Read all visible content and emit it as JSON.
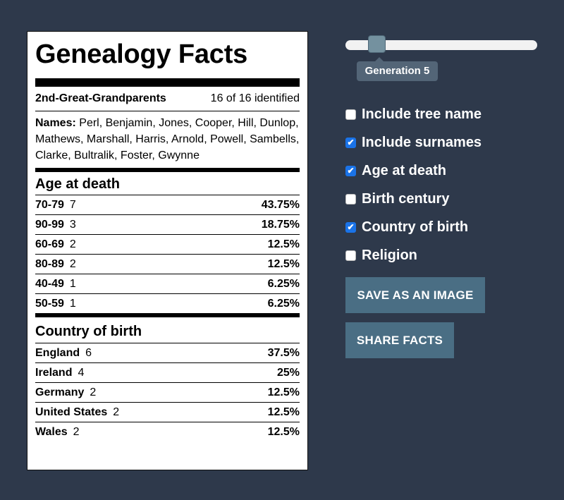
{
  "card": {
    "title": "Genealogy Facts",
    "generation_label": "2nd-Great-Grandparents",
    "identified": "16 of 16 identified",
    "names_label": "Names:",
    "names": "Perl, Benjamin, Jones, Cooper, Hill, Dunlop, Mathews, Marshall, Harris, Arnold, Powell, Sambells, Clarke, Bultralik, Foster, Gwynne",
    "age_section": {
      "heading": "Age at death",
      "rows": [
        {
          "label": "70-79",
          "count": "7",
          "percent": "43.75%"
        },
        {
          "label": "90-99",
          "count": "3",
          "percent": "18.75%"
        },
        {
          "label": "60-69",
          "count": "2",
          "percent": "12.5%"
        },
        {
          "label": "80-89",
          "count": "2",
          "percent": "12.5%"
        },
        {
          "label": "40-49",
          "count": "1",
          "percent": "6.25%"
        },
        {
          "label": "50-59",
          "count": "1",
          "percent": "6.25%"
        }
      ]
    },
    "country_section": {
      "heading": "Country of birth",
      "rows": [
        {
          "label": "England",
          "count": "6",
          "percent": "37.5%"
        },
        {
          "label": "Ireland",
          "count": "4",
          "percent": "25%"
        },
        {
          "label": "Germany",
          "count": "2",
          "percent": "12.5%"
        },
        {
          "label": "United States",
          "count": "2",
          "percent": "12.5%"
        },
        {
          "label": "Wales",
          "count": "2",
          "percent": "12.5%"
        }
      ]
    }
  },
  "controls": {
    "slider": {
      "value": 5,
      "tooltip": "Generation 5"
    },
    "options": [
      {
        "label": "Include tree name",
        "checked": false
      },
      {
        "label": "Include surnames",
        "checked": true
      },
      {
        "label": "Age at death",
        "checked": true
      },
      {
        "label": "Birth century",
        "checked": false
      },
      {
        "label": "Country of birth",
        "checked": true
      },
      {
        "label": "Religion",
        "checked": false
      }
    ],
    "save_button": "SAVE AS AN IMAGE",
    "share_button": "SHARE FACTS"
  }
}
